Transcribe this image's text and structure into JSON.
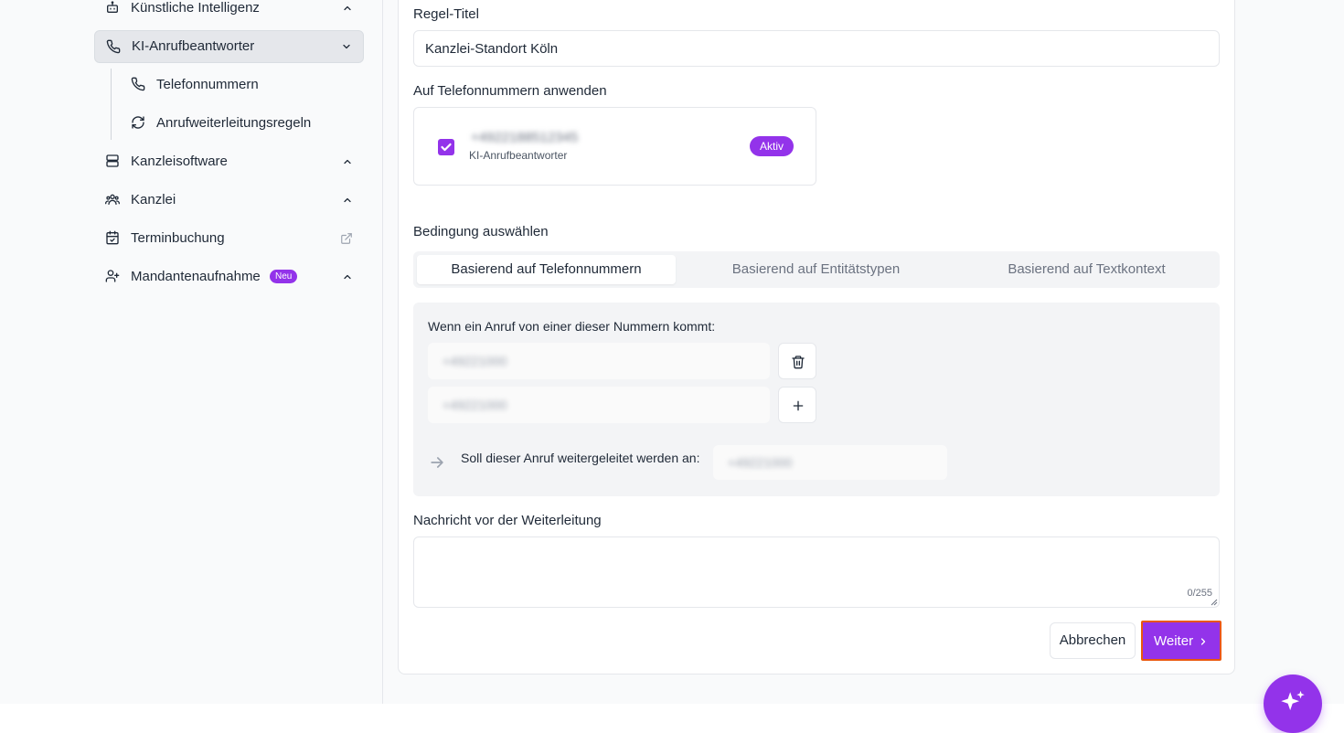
{
  "sidebar": {
    "items": [
      {
        "label": "Künstliche Intelligenz",
        "icon": "bot-icon"
      },
      {
        "label": "KI-Anrufbeantworter",
        "icon": "phone-icon"
      },
      {
        "label": "Kanzleisoftware",
        "icon": "server-icon"
      },
      {
        "label": "Kanzlei",
        "icon": "users-icon"
      },
      {
        "label": "Terminbuchung",
        "icon": "calendar-check-icon"
      },
      {
        "label": "Mandantenaufnahme",
        "icon": "user-plus-icon",
        "badge": "Neu"
      }
    ],
    "subitems": [
      {
        "label": "Telefonnummern",
        "icon": "phone-icon"
      },
      {
        "label": "Anrufweiterleitungsregeln",
        "icon": "refresh-icon"
      }
    ]
  },
  "form": {
    "title_label": "Regel-Titel",
    "title_value": "Kanzlei-Standort Köln",
    "apply_label": "Auf Telefonnummern anwenden",
    "phone_card": {
      "number": "+4922188512345",
      "subtitle": "KI-Anrufbeantworter",
      "status": "Aktiv"
    },
    "condition_label": "Bedingung auswählen",
    "tabs": [
      "Basierend auf Telefonnummern",
      "Basierend auf Entitätstypen",
      "Basierend auf Textkontext"
    ],
    "condition_text": "Wenn ein Anruf von einer dieser Nummern kommt:",
    "numbers": [
      "+49221000",
      "+49221000"
    ],
    "forward_label": "Soll dieser Anruf weitergeleitet werden an:",
    "forward_value": "+49221000",
    "message_label": "Nachricht vor der Weiterleitung",
    "counter": "0/255",
    "cancel_label": "Abbrechen",
    "next_label": "Weiter"
  },
  "colors": {
    "accent": "#9333ea",
    "focus_outline": "#ea580c"
  }
}
